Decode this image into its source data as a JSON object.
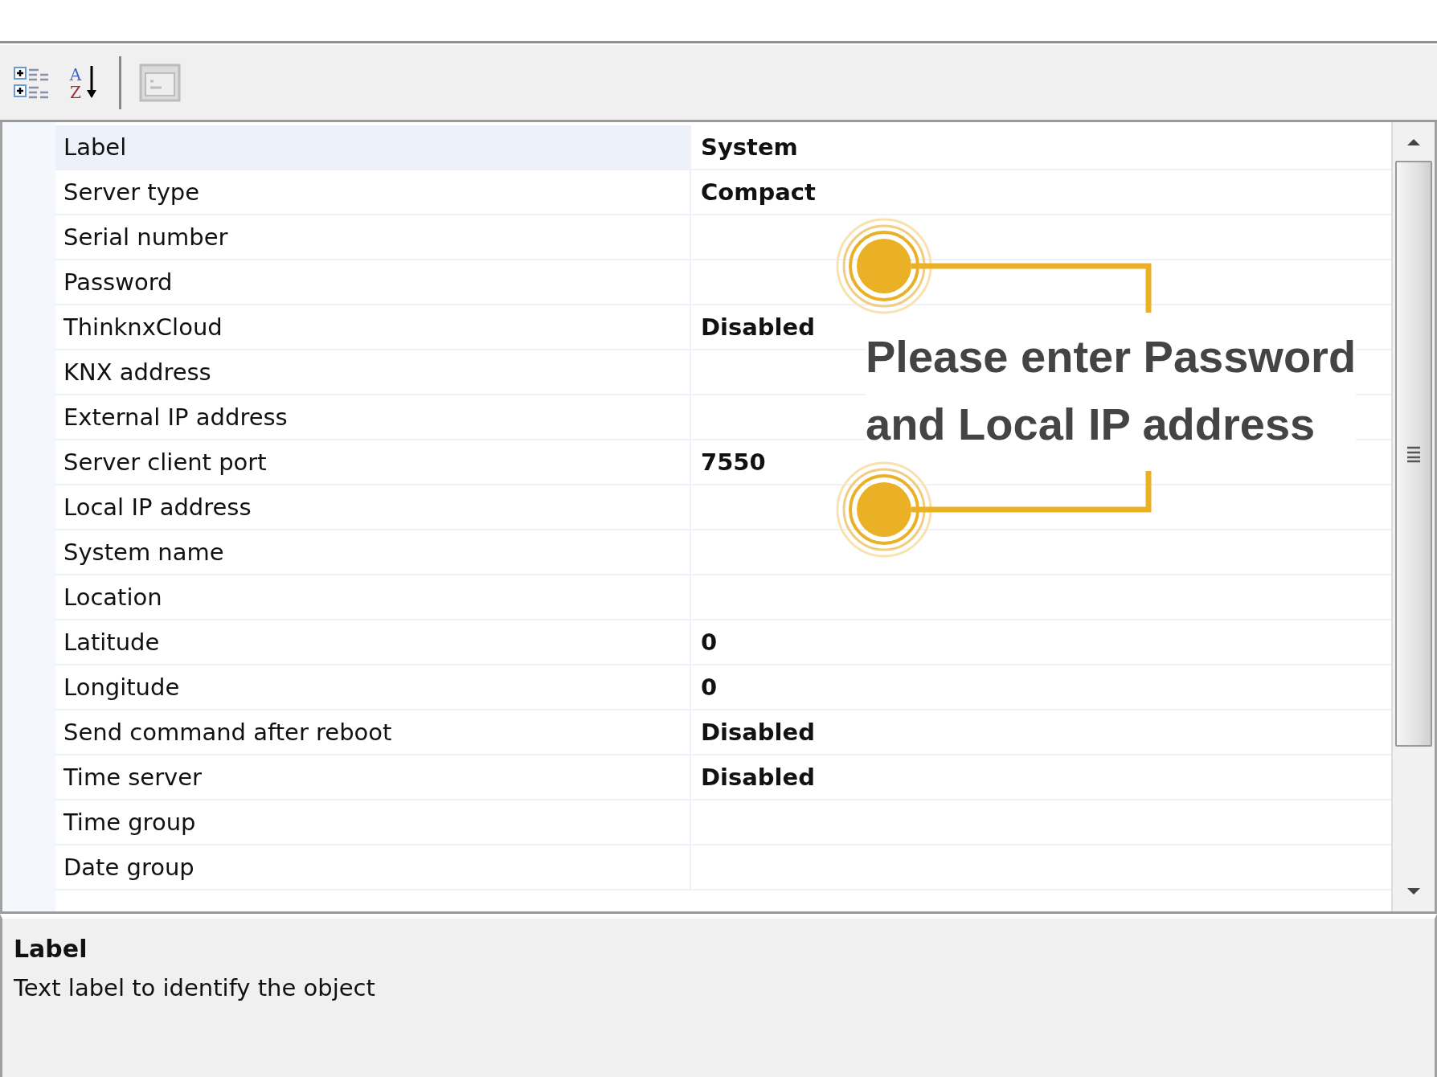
{
  "toolbar": {
    "buttons": [
      {
        "kind": "categorized",
        "disabled": false
      },
      {
        "kind": "alphabetical",
        "disabled": false,
        "glyph_top": "A",
        "glyph_bottom": "Z"
      },
      {
        "kind": "property-pages",
        "disabled": true
      }
    ]
  },
  "grid": {
    "rows": [
      {
        "label": "Label",
        "value": "System",
        "selected": true
      },
      {
        "label": "Server type",
        "value": "Compact",
        "selected": false
      },
      {
        "label": "Serial number",
        "value": "",
        "selected": false
      },
      {
        "label": "Password",
        "value": "",
        "selected": false
      },
      {
        "label": "ThinknxCloud",
        "value": "Disabled",
        "selected": false
      },
      {
        "label": "KNX address",
        "value": "",
        "selected": false
      },
      {
        "label": "External IP address",
        "value": "",
        "selected": false
      },
      {
        "label": "Server client port",
        "value": "7550",
        "selected": false
      },
      {
        "label": "Local IP address",
        "value": "",
        "selected": false
      },
      {
        "label": "System name",
        "value": "",
        "selected": false
      },
      {
        "label": "Location",
        "value": "",
        "selected": false
      },
      {
        "label": "Latitude",
        "value": "0",
        "selected": false
      },
      {
        "label": "Longitude",
        "value": "0",
        "selected": false
      },
      {
        "label": "Send command after reboot",
        "value": "Disabled",
        "selected": false
      },
      {
        "label": "Time server",
        "value": "Disabled",
        "selected": false
      },
      {
        "label": "Time group",
        "value": "",
        "selected": false
      },
      {
        "label": "Date group",
        "value": "",
        "selected": false
      }
    ]
  },
  "callout": {
    "lines": [
      "Please enter Password",
      "and Local IP address"
    ]
  },
  "description": {
    "title": "Label",
    "text": "Text label to identify the object"
  }
}
